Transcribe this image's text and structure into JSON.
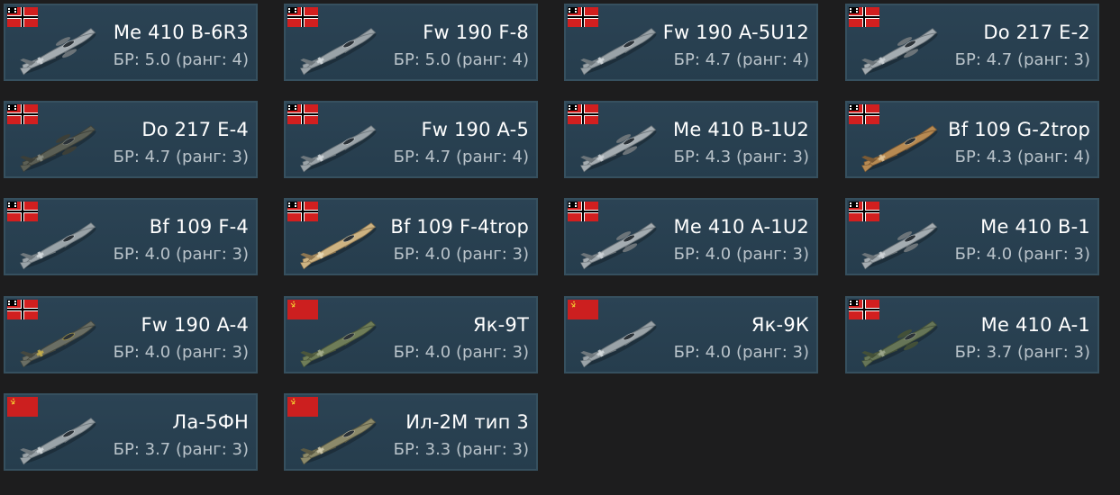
{
  "br_prefix": "БР:",
  "rank_prefix": "(ранг:",
  "rank_suffix": ")",
  "flag_colors": {
    "germany_red": "#d21f1f",
    "germany_white": "#ffffff",
    "germany_black": "#000000",
    "ussr_red": "#cc1f1f",
    "ussr_gold": "#f1c230"
  },
  "vehicles": [
    {
      "name": "Me 410 B-6R3",
      "br": "5.0",
      "rank": "4",
      "nation": "germany",
      "camo": "grey-bomber"
    },
    {
      "name": "Fw 190 F-8",
      "br": "5.0",
      "rank": "4",
      "nation": "germany",
      "camo": "grey-fighter"
    },
    {
      "name": "Fw 190 A-5U12",
      "br": "4.7",
      "rank": "4",
      "nation": "germany",
      "camo": "grey-fighter"
    },
    {
      "name": "Do 217 E-2",
      "br": "4.7",
      "rank": "3",
      "nation": "germany",
      "camo": "grey-bomber"
    },
    {
      "name": "Do 217 E-4",
      "br": "4.7",
      "rank": "3",
      "nation": "germany",
      "camo": "dark-bomber"
    },
    {
      "name": "Fw 190 A-5",
      "br": "4.7",
      "rank": "4",
      "nation": "germany",
      "camo": "grey-fighter"
    },
    {
      "name": "Me 410 B-1U2",
      "br": "4.3",
      "rank": "3",
      "nation": "germany",
      "camo": "grey-bomber"
    },
    {
      "name": "Bf 109 G-2trop",
      "br": "4.3",
      "rank": "4",
      "nation": "germany",
      "camo": "desert-fighter"
    },
    {
      "name": "Bf 109 F-4",
      "br": "4.0",
      "rank": "3",
      "nation": "germany",
      "camo": "grey-fighter"
    },
    {
      "name": "Bf 109 F-4trop",
      "br": "4.0",
      "rank": "3",
      "nation": "germany",
      "camo": "sand-fighter"
    },
    {
      "name": "Me 410 A-1U2",
      "br": "4.0",
      "rank": "3",
      "nation": "germany",
      "camo": "grey-bomber"
    },
    {
      "name": "Me 410 B-1",
      "br": "4.0",
      "rank": "3",
      "nation": "germany",
      "camo": "grey-bomber"
    },
    {
      "name": "Fw 190 A-4",
      "br": "4.0",
      "rank": "3",
      "nation": "germany",
      "camo": "dark-fighter"
    },
    {
      "name": "Як-9Т",
      "br": "4.0",
      "rank": "3",
      "nation": "ussr",
      "camo": "green-fighter"
    },
    {
      "name": "Як-9К",
      "br": "4.0",
      "rank": "3",
      "nation": "ussr",
      "camo": "grey-fighter"
    },
    {
      "name": "Me 410 A-1",
      "br": "3.7",
      "rank": "3",
      "nation": "germany",
      "camo": "green-bomber"
    },
    {
      "name": "Ла-5ФН",
      "br": "3.7",
      "rank": "3",
      "nation": "ussr",
      "camo": "grey-fighter"
    },
    {
      "name": "Ил-2М тип 3",
      "br": "3.3",
      "rank": "3",
      "nation": "ussr",
      "camo": "camo-attacker"
    }
  ]
}
